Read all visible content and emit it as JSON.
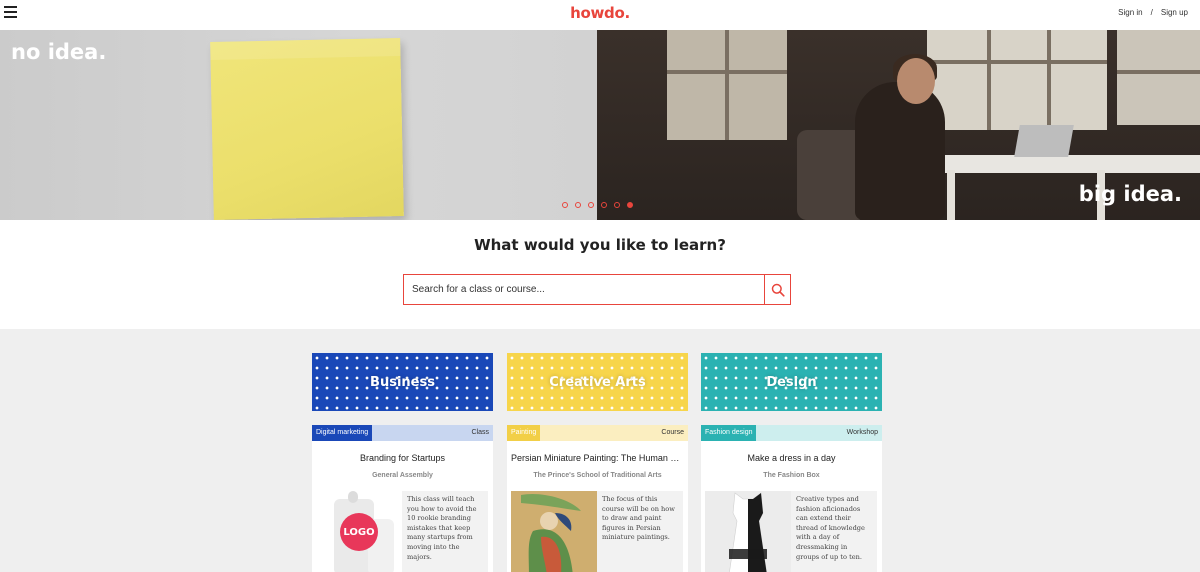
{
  "header": {
    "logo": "howdo.",
    "sign_in": "Sign in",
    "separator": "/",
    "sign_up": "Sign up"
  },
  "hero": {
    "left_caption": "no idea.",
    "right_caption": "big idea.",
    "slides_total": 6,
    "active_slide": 6
  },
  "search": {
    "title": "What would you like to learn?",
    "placeholder": "Search for a class or course..."
  },
  "categories": [
    {
      "label": "Business",
      "color": "#1a48b8"
    },
    {
      "label": "Creative Arts",
      "color": "#f7d54b"
    },
    {
      "label": "Design",
      "color": "#2bb2b2"
    }
  ],
  "cards": [
    {
      "tag": "Digital marketing",
      "tag_color": "#1a48b8",
      "bar_color": "#c8d6f0",
      "type": "Class",
      "title": "Branding for Startups",
      "org": "General Assembly",
      "image_text": "LOGO",
      "description": "This class will teach you how to avoid the 10 rookie branding mistakes that keep many startups from moving into the majors."
    },
    {
      "tag": "Painting",
      "tag_color": "#f2cf47",
      "bar_color": "#fbeec0",
      "type": "Course",
      "title": "Persian Miniature Painting: The Human Fig...",
      "org": "The Prince's School of Traditional Arts",
      "description": "The focus of this course will be on how to draw and paint figures in Persian miniature paintings."
    },
    {
      "tag": "Fashion design",
      "tag_color": "#2bb2b2",
      "bar_color": "#cdeeee",
      "type": "Workshop",
      "title": "Make a dress in a day",
      "org": "The Fashion Box",
      "description": "Creative types and fashion aficionados can extend their thread of knowledge with a day of dressmaking in groups of up to ten."
    }
  ]
}
